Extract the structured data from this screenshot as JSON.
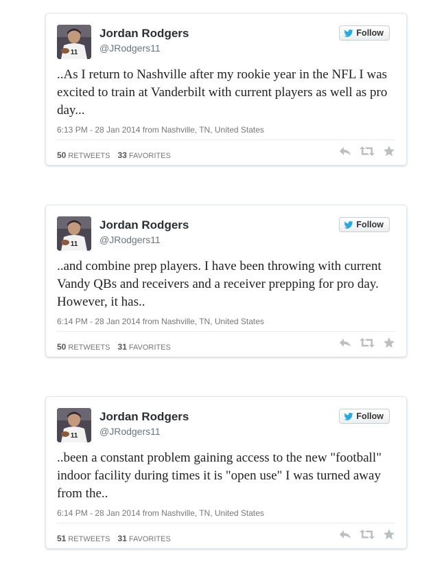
{
  "colors": {
    "bird": "#2aa9e0",
    "icon": "#b9bfc3"
  },
  "tweets": [
    {
      "name": "Jordan Rodgers",
      "handle": "@JRodgers11",
      "follow_label": "Follow",
      "text": "..As I return to Nashville after my rookie year in the NFL I was excited to train at Vanderbilt with current players as well as pro day...",
      "meta": "6:13 PM - 28 Jan 2014 from Nashville, TN, United States",
      "retweets": "50",
      "retweets_label": "RETWEETS",
      "favorites": "33",
      "favorites_label": "FAVORITES"
    },
    {
      "name": "Jordan Rodgers",
      "handle": "@JRodgers11",
      "follow_label": "Follow",
      "text": "..and combine prep players. I have been throwing with current Vandy QBs and receivers and a receiver prepping for pro day. However, it has..",
      "meta": "6:14 PM - 28 Jan 2014 from Nashville, TN, United States",
      "retweets": "50",
      "retweets_label": "RETWEETS",
      "favorites": "31",
      "favorites_label": "FAVORITES"
    },
    {
      "name": "Jordan Rodgers",
      "handle": "@JRodgers11",
      "follow_label": "Follow",
      "text": "..been a constant problem gaining access to the new \"football\" indoor facility during times it is \"open use\" I was turned away from the..",
      "meta": "6:14 PM - 28 Jan 2014 from Nashville, TN, United States",
      "retweets": "51",
      "retweets_label": "RETWEETS",
      "favorites": "31",
      "favorites_label": "FAVORITES"
    }
  ]
}
